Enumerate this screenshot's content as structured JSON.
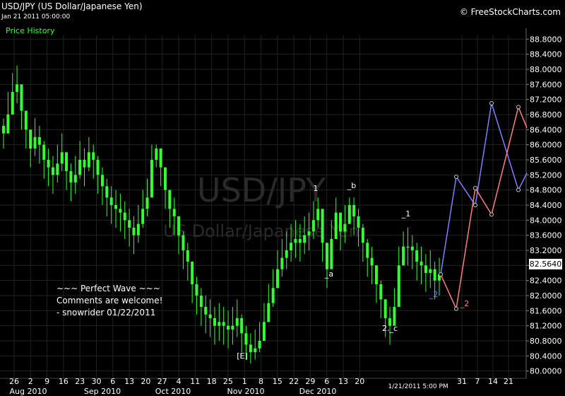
{
  "header": {
    "title": "USD/JPY (US Dollar/Japanese Yen)",
    "datetime": "Jan 21 2011 05:00:00",
    "series_label": "Price History",
    "brand": "© FreeStockCharts.com"
  },
  "watermark": {
    "symbol": "USD/JPY",
    "name": "US Dollar/Japanese Yen"
  },
  "current_price": "82.5640",
  "last_bar_label": "1/21/2011 5:00 PM",
  "note_lines": [
    "~~~ Perfect Wave ~~~",
    "Comments are welcome!",
    "- snowrider  01/22/2011"
  ],
  "colors": {
    "candles": "#33ff33",
    "projection_blue": "#7f7fff",
    "projection_red": "#ff7f7f",
    "grid": "#222222"
  },
  "chart_data": {
    "type": "line",
    "title": "USD/JPY (US Dollar/Japanese Yen)",
    "ylim": [
      79.9,
      88.9
    ],
    "y_ticks": [
      "88.8000",
      "88.4000",
      "88.0000",
      "87.6000",
      "87.2000",
      "86.8000",
      "86.4000",
      "86.0000",
      "85.6000",
      "85.2000",
      "84.8000",
      "84.4000",
      "84.0000",
      "83.6000",
      "83.2000",
      "82.8000",
      "82.4000",
      "82.0000",
      "81.6000",
      "81.2000",
      "80.8000",
      "80.4000",
      "80.0000"
    ],
    "x_day_ticks": [
      "26",
      "2",
      "9",
      "16",
      "23",
      "30",
      "6",
      "13",
      "20",
      "27",
      "4",
      "11",
      "18",
      "25",
      "1",
      "8",
      "15",
      "22",
      "29",
      "6",
      "13",
      "20",
      "31",
      "7",
      "14",
      "21"
    ],
    "x_month_labels": [
      "Aug 2010",
      "Sep 2010",
      "Oct 2010",
      "Nov 2010",
      "Dec 2010"
    ],
    "price_series": {
      "name": "Price History",
      "close": [
        86.3,
        86.8,
        87.4,
        87.6,
        86.9,
        86.4,
        85.9,
        86.2,
        86.0,
        85.6,
        85.4,
        85.2,
        85.5,
        85.8,
        85.3,
        85.0,
        85.2,
        85.6,
        85.4,
        85.8,
        85.6,
        85.2,
        84.9,
        84.6,
        84.4,
        84.3,
        84.2,
        84.0,
        83.8,
        83.6,
        83.9,
        84.3,
        84.6,
        85.6,
        85.9,
        85.4,
        84.8,
        84.3,
        84.1,
        83.6,
        83.2,
        82.9,
        82.3,
        82.0,
        81.7,
        81.5,
        81.4,
        81.2,
        81.3,
        81.2,
        81.1,
        81.2,
        81.4,
        81.0,
        80.7,
        80.5,
        80.6,
        80.8,
        81.3,
        81.8,
        82.2,
        82.7,
        83.0,
        83.2,
        83.4,
        83.5,
        83.4,
        83.6,
        83.7,
        84.0,
        84.3,
        83.4,
        82.7,
        83.5,
        84.2,
        83.7,
        83.9,
        84.4,
        84.1,
        83.8,
        83.4,
        83.0,
        82.8,
        82.3,
        81.9,
        81.4,
        81.2,
        81.7,
        82.8,
        83.3,
        83.3,
        83.2,
        82.9,
        82.8,
        82.6,
        82.7,
        82.4,
        82.56
      ],
      "highs": [
        86.7,
        87.4,
        87.9,
        88.1,
        87.3,
        86.9,
        86.4,
        86.7,
        86.5,
        86.1,
        85.9,
        85.7,
        86.0,
        86.3,
        85.8,
        85.5,
        85.7,
        86.1,
        85.9,
        86.2,
        86.0,
        85.7,
        85.4,
        85.1,
        84.9,
        84.8,
        84.7,
        84.5,
        84.3,
        84.1,
        84.4,
        84.8,
        85.1,
        86.0,
        86.0,
        85.8,
        85.3,
        84.8,
        84.6,
        84.1,
        83.7,
        83.4,
        82.8,
        82.5,
        82.2,
        82.0,
        81.9,
        81.7,
        81.8,
        81.7,
        81.6,
        81.7,
        81.9,
        81.5,
        81.2,
        81.0,
        81.1,
        81.3,
        81.8,
        82.3,
        82.7,
        83.2,
        83.5,
        83.7,
        83.9,
        84.0,
        83.9,
        84.1,
        84.2,
        84.5,
        84.6,
        83.9,
        83.2,
        84.0,
        84.6,
        84.2,
        84.4,
        84.6,
        84.6,
        84.3,
        83.9,
        83.5,
        83.3,
        82.8,
        82.4,
        81.9,
        81.7,
        82.2,
        83.3,
        83.7,
        83.8,
        83.6,
        83.4,
        83.3,
        83.1,
        83.2,
        82.9,
        83.0
      ],
      "lows": [
        85.9,
        86.3,
        86.9,
        87.1,
        86.4,
        85.9,
        85.4,
        85.7,
        85.5,
        85.1,
        84.9,
        84.7,
        85.0,
        85.3,
        84.8,
        84.5,
        84.7,
        85.1,
        84.9,
        85.3,
        85.1,
        84.7,
        84.4,
        84.1,
        83.9,
        83.8,
        83.7,
        83.5,
        83.3,
        83.1,
        83.4,
        83.8,
        84.1,
        85.1,
        85.4,
        84.9,
        84.3,
        83.8,
        83.6,
        83.1,
        82.7,
        82.4,
        81.8,
        81.5,
        81.2,
        81.0,
        80.9,
        80.7,
        80.8,
        80.7,
        80.6,
        80.7,
        80.9,
        80.5,
        80.3,
        80.2,
        80.3,
        80.5,
        80.8,
        81.3,
        81.7,
        82.2,
        82.5,
        82.7,
        82.9,
        83.0,
        82.9,
        83.1,
        83.2,
        83.5,
        83.8,
        82.9,
        82.2,
        83.0,
        83.7,
        83.2,
        83.4,
        83.9,
        83.6,
        83.3,
        82.9,
        82.5,
        82.3,
        81.8,
        81.4,
        80.9,
        80.7,
        81.2,
        82.3,
        82.8,
        82.8,
        82.7,
        82.4,
        82.3,
        82.1,
        82.2,
        81.9,
        82.0
      ]
    },
    "projection_blue": {
      "y": [
        82.56,
        85.15,
        84.4,
        87.1,
        84.8,
        85.25
      ]
    },
    "projection_red": {
      "y": [
        82.56,
        81.65,
        84.85,
        84.15,
        87.0,
        86.45
      ]
    },
    "wave_labels": [
      {
        "text": "1",
        "color": "#ffffff"
      },
      {
        "text": "_b",
        "color": "#ffffff"
      },
      {
        "text": "_a",
        "color": "#ffffff"
      },
      {
        "text": "_1",
        "color": "#ffffff"
      },
      {
        "text": "2._c",
        "color": "#ffffff"
      },
      {
        "text": "[E]",
        "color": "#ffffff"
      },
      {
        "text": "_2",
        "color": "#7f7fff"
      },
      {
        "text": "_2",
        "color": "#ff7f7f"
      }
    ]
  }
}
